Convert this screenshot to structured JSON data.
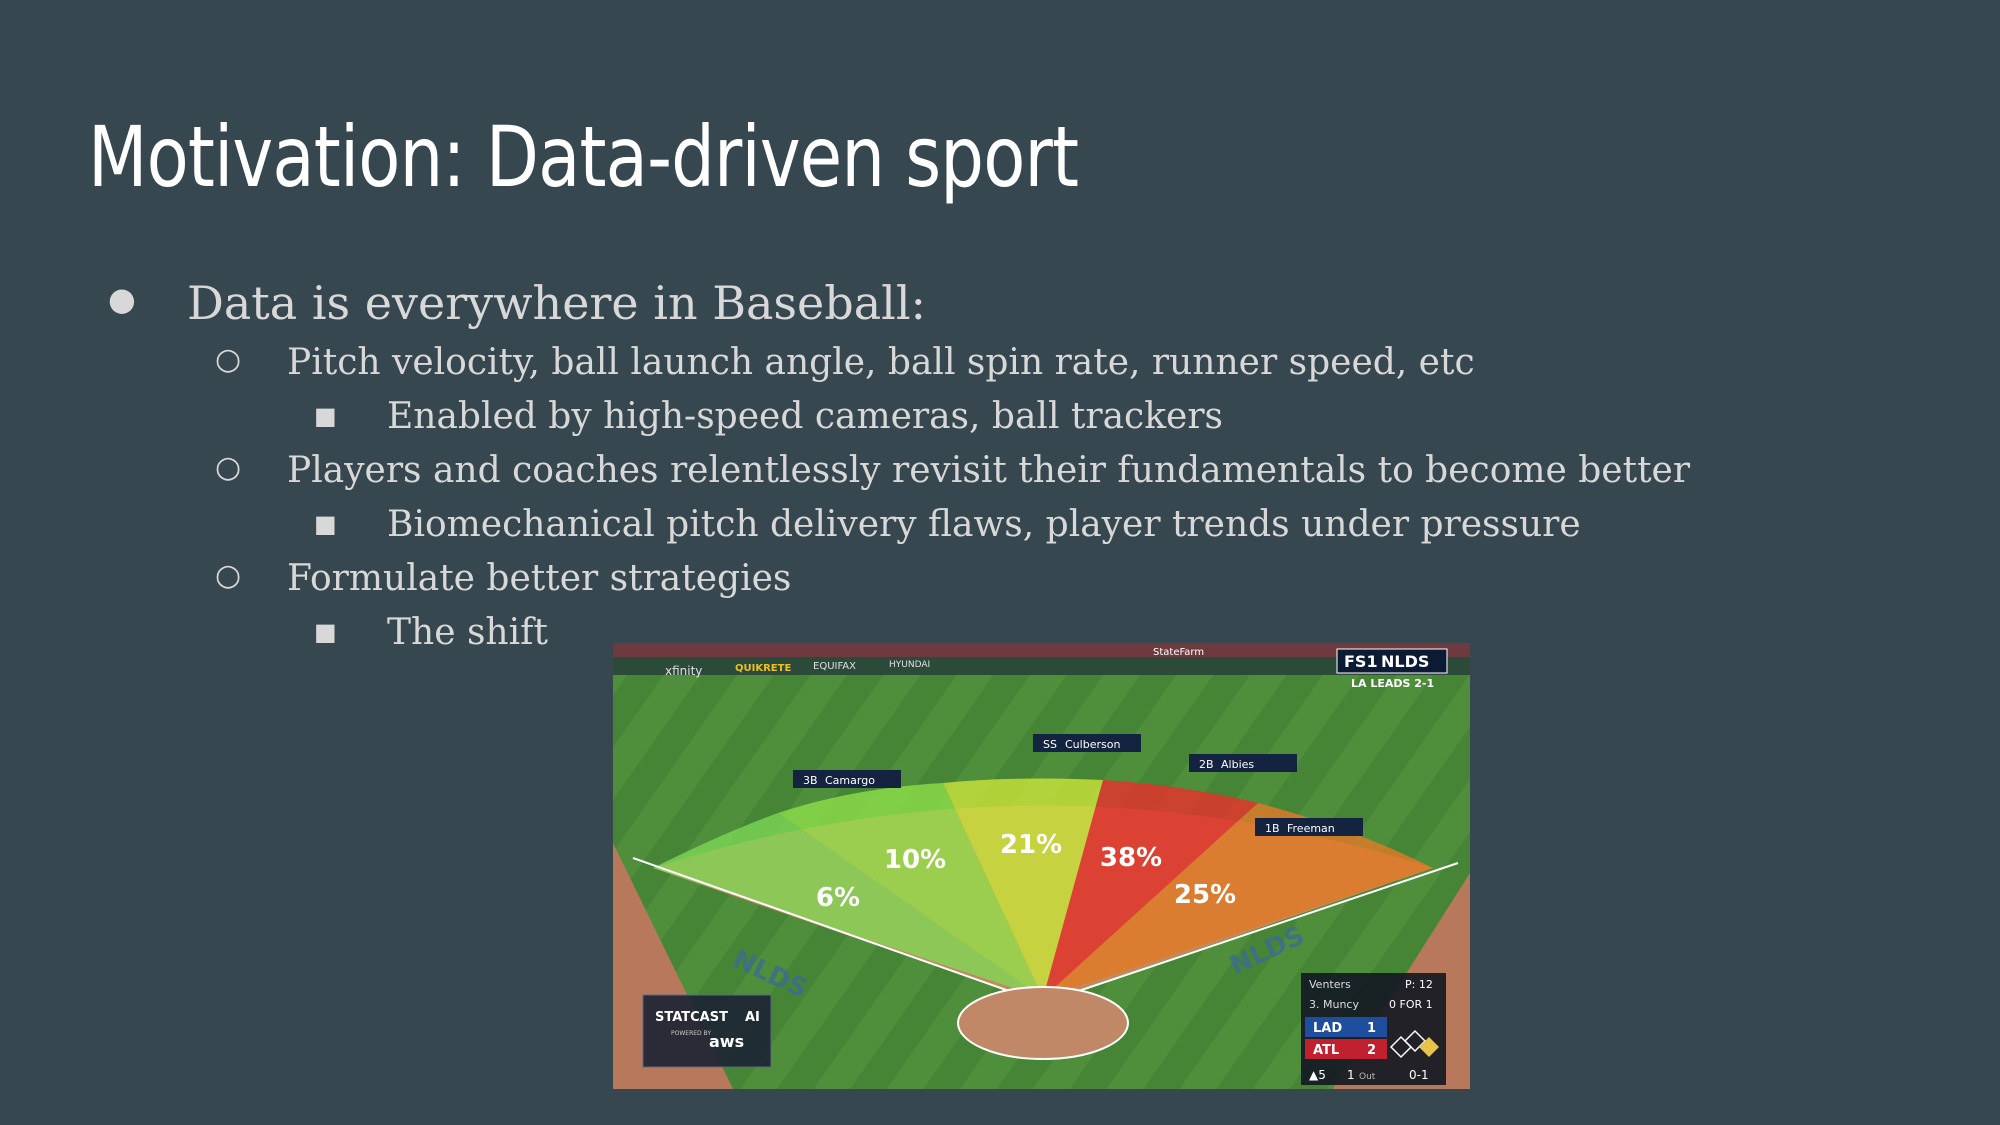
{
  "slide": {
    "title": "Motivation: Data-driven sport",
    "bullets": [
      {
        "level": 1,
        "marker": "●",
        "text": "Data is everywhere in Baseball:"
      },
      {
        "level": 2,
        "marker": "○",
        "text": "Pitch velocity, ball launch angle, ball spin rate, runner speed, etc"
      },
      {
        "level": 3,
        "marker": "■",
        "text": "Enabled by high-speed cameras, ball trackers"
      },
      {
        "level": 2,
        "marker": "○",
        "text": "Players and coaches relentlessly revisit their fundamentals to become better"
      },
      {
        "level": 3,
        "marker": "■",
        "text": "Biomechanical pitch delivery flaws, player trends under pressure"
      },
      {
        "level": 2,
        "marker": "○",
        "text": "Formulate better strategies"
      },
      {
        "level": 3,
        "marker": "■",
        "text": "The shift"
      }
    ]
  },
  "figure": {
    "network": "FS1",
    "series": "NLDS",
    "series_status": "LA LEADS 2-1",
    "ads": [
      "xfinity",
      "QUIKRETE",
      "EQUIFAX",
      "HYUNDAI",
      "StateFarm"
    ],
    "players": [
      {
        "pos": "3B",
        "name": "Camargo"
      },
      {
        "pos": "SS",
        "name": "Culberson"
      },
      {
        "pos": "2B",
        "name": "Albies"
      },
      {
        "pos": "1B",
        "name": "Freeman"
      }
    ],
    "zones": [
      {
        "pct": "6%",
        "color": "#7ed957"
      },
      {
        "pct": "10%",
        "color": "#8fe04a"
      },
      {
        "pct": "21%",
        "color": "#c8e23a"
      },
      {
        "pct": "38%",
        "color": "#e0352b"
      },
      {
        "pct": "25%",
        "color": "#e07a28"
      }
    ],
    "statcast": {
      "brand": "STATCAST",
      "suffix": "AI",
      "powered": "POWERED BY",
      "vendor": "aws"
    },
    "scorebug": {
      "pitcher": "Venters",
      "pitch_count": "P: 12",
      "batter": "3. Muncy",
      "batter_line": "0 FOR 1",
      "teams": [
        {
          "abbr": "LAD",
          "score": "1",
          "color": "#1f4e9e"
        },
        {
          "abbr": "ATL",
          "score": "2",
          "color": "#c0202f"
        }
      ],
      "inning": "▲5",
      "outs": "1",
      "outs_label": "Out",
      "count": "0-1"
    },
    "logo_text": "NLDS"
  }
}
